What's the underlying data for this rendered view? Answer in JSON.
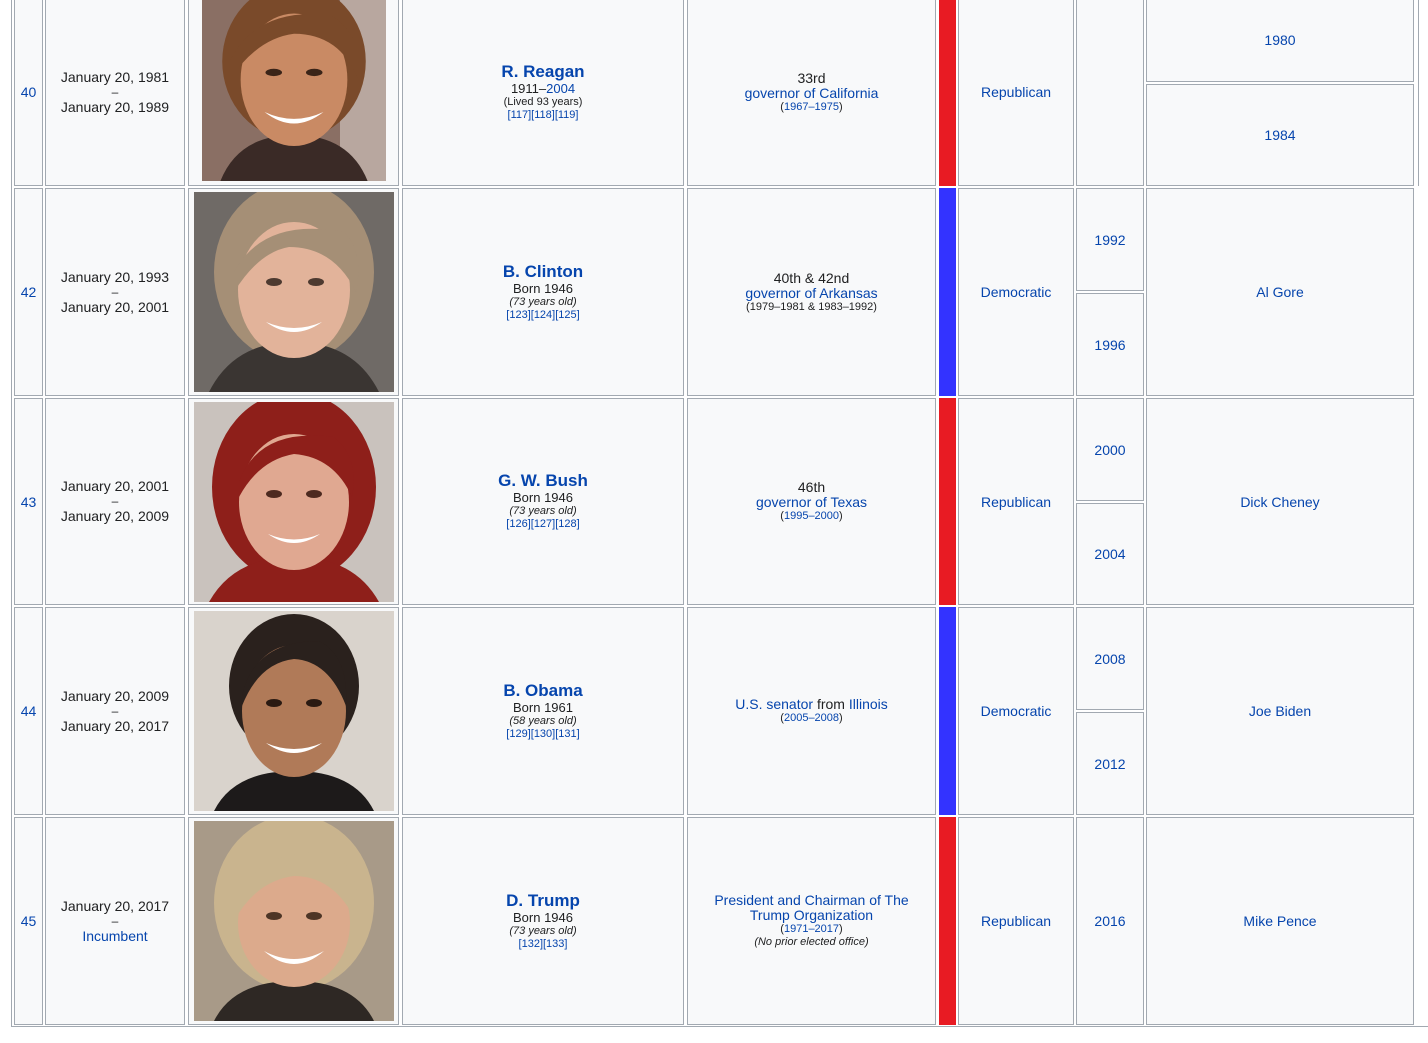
{
  "colors": {
    "republican": "#e81b23",
    "democratic": "#3333ff",
    "link": "#0645ad"
  },
  "rows": [
    {
      "number": "40",
      "took_office": "January 20, 1981",
      "dash": "–",
      "left_office": "January 20, 1989",
      "photo_icon": "portrait-woman-brown-hair",
      "name": "R. Reagan",
      "life_prefix": "1911–",
      "life_link": "2004",
      "age": "(Lived 93 years)",
      "refs": "[117][118][119]",
      "office_ordinal": "33rd",
      "office_text": "governor of California",
      "office_years": "(1967–1975)",
      "party": "Republican",
      "party_color": "#e81b23",
      "elections": [
        "1980",
        "1984"
      ],
      "vp": ""
    },
    {
      "number": "42",
      "took_office": "January 20, 1993",
      "dash": "–",
      "left_office": "January 20, 2001",
      "photo_icon": "portrait-woman-light-hair",
      "name": "B. Clinton",
      "life": "Born 1946",
      "age": "(73 years old)",
      "refs": "[123][124][125]",
      "office_ordinal": "40th & 42nd",
      "office_text": "governor of Arkansas",
      "office_years": "(1979–1981 & 1983–1992)",
      "party": "Democratic",
      "party_color": "#3333ff",
      "elections": [
        "1992",
        "1996"
      ],
      "vp": "Al Gore"
    },
    {
      "number": "43",
      "took_office": "January 20, 2001",
      "dash": "–",
      "left_office": "January 20, 2009",
      "photo_icon": "portrait-woman-red-hair",
      "name": "G. W. Bush",
      "life": "Born 1946",
      "age": "(73 years old)",
      "refs": "[126][127][128]",
      "office_ordinal": "46th",
      "office_text": "governor of Texas",
      "office_years": "(1995–2000)",
      "party": "Republican",
      "party_color": "#e81b23",
      "elections": [
        "2000",
        "2004"
      ],
      "vp": "Dick Cheney"
    },
    {
      "number": "44",
      "took_office": "January 20, 2009",
      "dash": "–",
      "left_office": "January 20, 2017",
      "photo_icon": "portrait-woman-dark-hair",
      "name": "B. Obama",
      "life": "Born 1961",
      "age": "(58 years old)",
      "refs": "[129][130][131]",
      "office_link1": "U.S. senator",
      "office_mid": " from ",
      "office_link2": "Illinois",
      "office_years": "(2005–2008)",
      "party": "Democratic",
      "party_color": "#3333ff",
      "elections": [
        "2008",
        "2012"
      ],
      "vp": "Joe Biden"
    },
    {
      "number": "45",
      "took_office": "January 20, 2017",
      "dash": "–",
      "left_office": "Incumbent",
      "photo_icon": "portrait-woman-blonde-hair",
      "name": "D. Trump",
      "life": "Born 1946",
      "age": "(73 years old)",
      "refs": "[132][133]",
      "office_text": "President and Chairman of The Trump Organization",
      "office_years": "(1971–2017)",
      "office_note": "(No prior elected office)",
      "party": "Republican",
      "party_color": "#e81b23",
      "elections": [
        "2016"
      ],
      "vp": "Mike Pence"
    }
  ]
}
